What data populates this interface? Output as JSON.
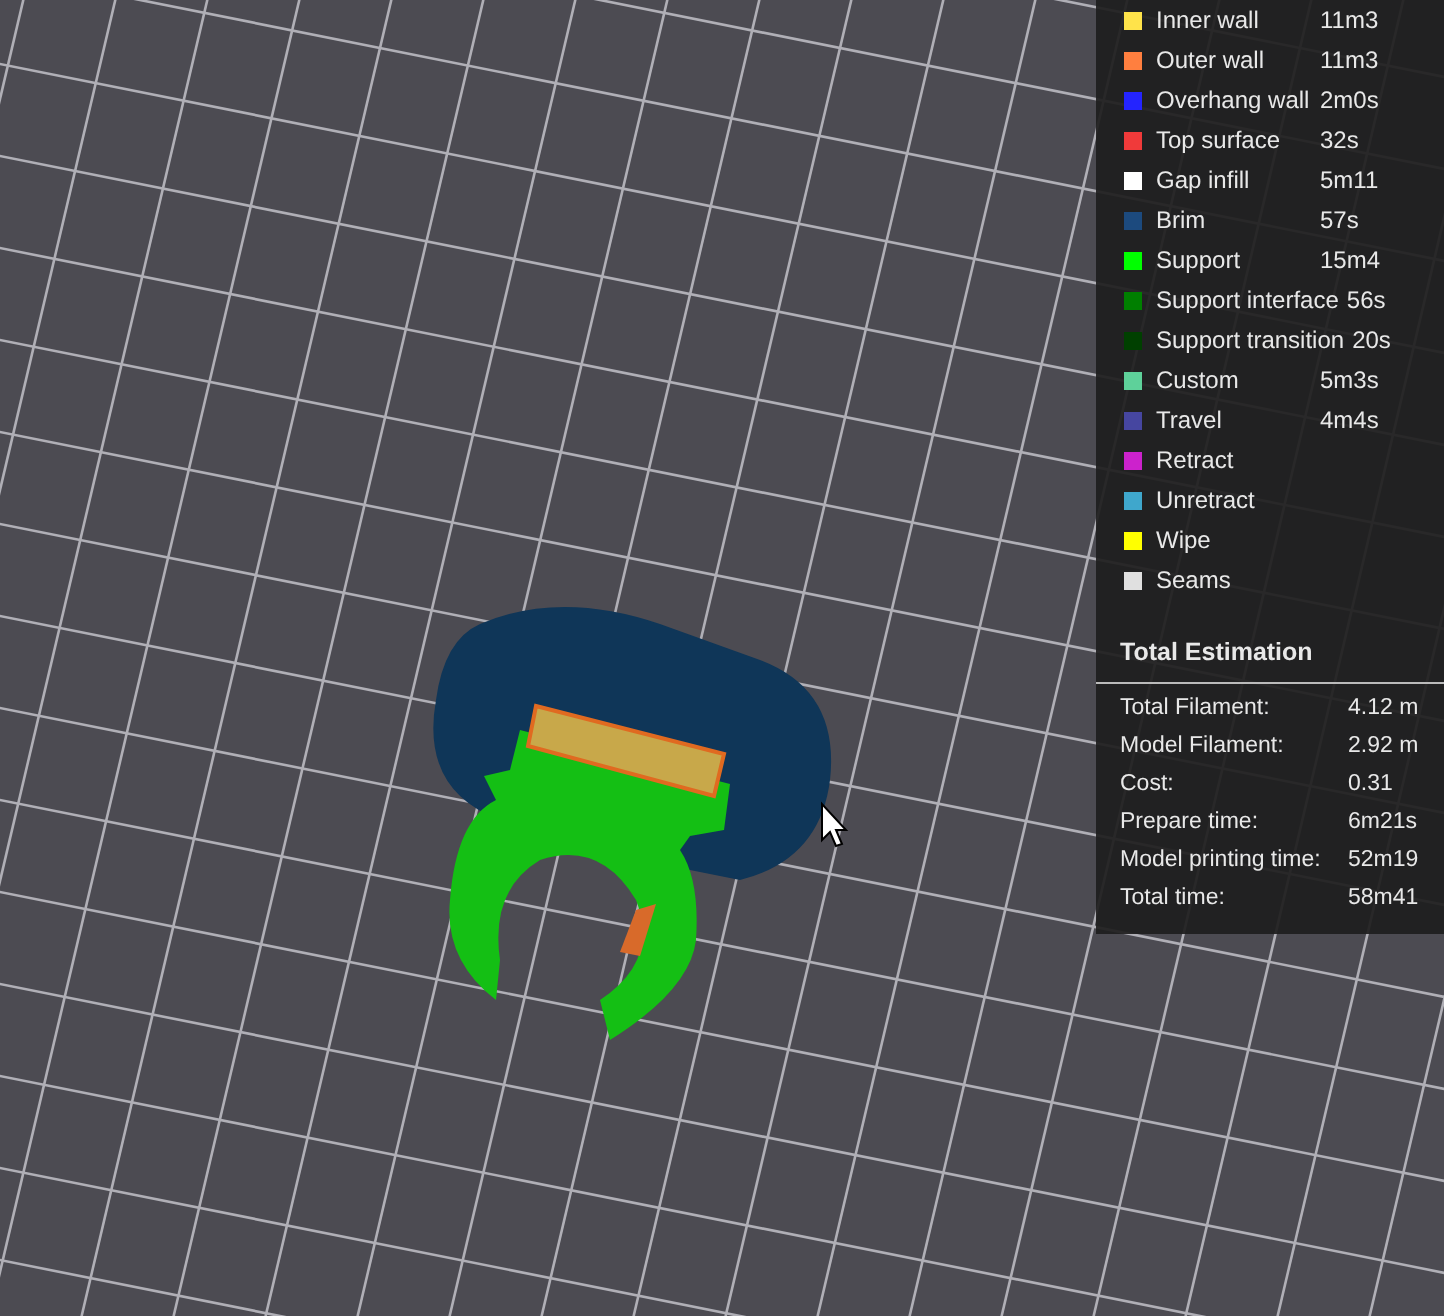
{
  "legend": {
    "items": [
      {
        "label": "Inner wall",
        "time": "11m3",
        "color": "#ffe34a"
      },
      {
        "label": "Outer wall",
        "time": "11m3",
        "color": "#ff7f3f"
      },
      {
        "label": "Overhang wall",
        "time": "2m0s",
        "color": "#2424ff"
      },
      {
        "label": "Top surface",
        "time": "32s",
        "color": "#f03a3a"
      },
      {
        "label": "Gap infill",
        "time": "5m11",
        "color": "#ffffff"
      },
      {
        "label": "Brim",
        "time": "57s",
        "color": "#1c4a7e"
      },
      {
        "label": "Support",
        "time": "15m4",
        "color": "#00ff00"
      },
      {
        "label": "Support interface",
        "time": "56s",
        "color": "#007f00"
      },
      {
        "label": "Support transition",
        "time": "20s",
        "color": "#004000"
      },
      {
        "label": "Custom",
        "time": "5m3s",
        "color": "#5ed19a"
      },
      {
        "label": "Travel",
        "time": "4m4s",
        "color": "#4646a0"
      },
      {
        "label": "Retract",
        "color": "#cc22cc"
      },
      {
        "label": "Unretract",
        "color": "#3fa7cc"
      },
      {
        "label": "Wipe",
        "color": "#ffff00"
      },
      {
        "label": "Seams",
        "color": "#e0e0e0"
      }
    ]
  },
  "total_estimation": {
    "title": "Total Estimation",
    "rows": [
      {
        "label": "Total Filament:",
        "value": "4.12 m"
      },
      {
        "label": "Model Filament:",
        "value": "2.92 m"
      },
      {
        "label": "Cost:",
        "value": "0.31"
      },
      {
        "label": "Prepare time:",
        "value": "6m21s"
      },
      {
        "label": "Model printing time:",
        "value": "52m19"
      },
      {
        "label": "Total time:",
        "value": "58m41"
      }
    ]
  }
}
